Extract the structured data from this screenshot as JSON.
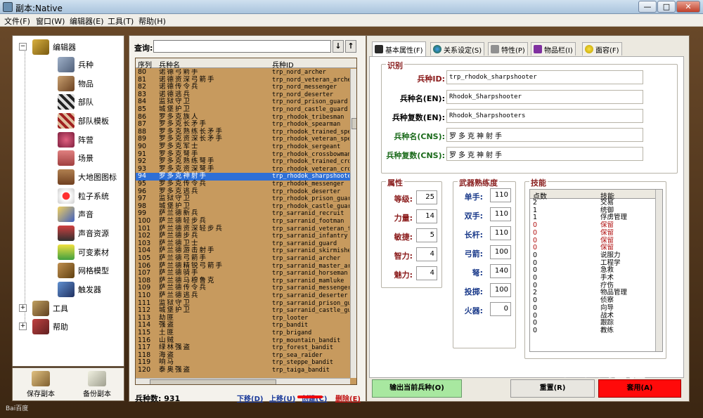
{
  "window": {
    "title": "副本:Native",
    "minimize": "—",
    "maximize": "□",
    "close": "✕"
  },
  "menu": [
    "文件(F)",
    "窗口(W)",
    "编辑器(E)",
    "工具(T)",
    "帮助(H)"
  ],
  "tree": {
    "root_label": "编辑器",
    "children": [
      "兵种",
      "物品",
      "部队",
      "部队模板",
      "阵营",
      "场景",
      "大地图图标",
      "粒子系统",
      "声音",
      "声音资源",
      "可变素材",
      "网格模型",
      "触发器"
    ],
    "tools_label": "工具",
    "help_label": "帮助"
  },
  "bottom_left": {
    "save": "保存副本",
    "backup": "备份副本"
  },
  "query": {
    "label": "查询:",
    "value": "",
    "up": "↓",
    "down": "↑"
  },
  "table": {
    "headers": [
      "序列",
      "兵种名",
      "兵种ID"
    ],
    "rows": [
      [
        "80",
        "诺德弓箭手",
        "trp_nord_archer"
      ],
      [
        "81",
        "诺德资深弓箭手",
        "trp_nord_veteran_archer"
      ],
      [
        "82",
        "诺德传令兵",
        "trp_nord_messenger"
      ],
      [
        "83",
        "诺德逃兵",
        "trp_nord_deserter"
      ],
      [
        "84",
        "监狱守卫",
        "trp_nord_prison_guard"
      ],
      [
        "85",
        "城堡护卫",
        "trp_nord_castle_guard"
      ],
      [
        "86",
        "罗多克族人",
        "trp_rhodok_tribesman"
      ],
      [
        "87",
        "罗多克长矛手",
        "trp_rhodok_spearman"
      ],
      [
        "88",
        "罗多克熟练长矛手",
        "trp_rhodok_trained_spearman"
      ],
      [
        "89",
        "罗多克资深长矛手",
        "trp_rhodok_veteran_spearman"
      ],
      [
        "90",
        "罗多克军士",
        "trp_rhodok_sergeant"
      ],
      [
        "91",
        "罗多克弩手",
        "trp_rhodok_crossbowman"
      ],
      [
        "92",
        "罗多克熟练弩手",
        "trp_rhodok_trained_crossbowman"
      ],
      [
        "93",
        "罗多克资深弩手",
        "trp_rhodok_veteran_crossbowman"
      ],
      [
        "94",
        "罗多克神射手",
        "trp_rhodok_sharpshooter"
      ],
      [
        "95",
        "罗多克传令兵",
        "trp_rhodok_messenger"
      ],
      [
        "96",
        "罗多克逃兵",
        "trp_rhodok_deserter"
      ],
      [
        "97",
        "监狱守卫",
        "trp_rhodok_prison_guard"
      ],
      [
        "98",
        "城堡护卫",
        "trp_rhodok_castle_guard"
      ],
      [
        "99",
        "萨兰德新兵",
        "trp_sarranid_recruit"
      ],
      [
        "100",
        "萨兰德轻步兵",
        "trp_sarranid_footman"
      ],
      [
        "101",
        "萨兰德资深轻步兵",
        "trp_sarranid_veteran_footman"
      ],
      [
        "102",
        "萨兰德步兵",
        "trp_sarranid_infantry"
      ],
      [
        "103",
        "萨兰德卫士",
        "trp_sarranid_guard"
      ],
      [
        "104",
        "萨兰德游击射手",
        "trp_sarranid_skirmisher"
      ],
      [
        "105",
        "萨兰德弓箭手",
        "trp_sarranid_archer"
      ],
      [
        "106",
        "萨兰德精锐弓箭手",
        "trp_sarranid_master_archer"
      ],
      [
        "107",
        "萨兰德骑手",
        "trp_sarranid_horseman"
      ],
      [
        "108",
        "萨兰德马穆鲁克",
        "trp_sarranid_mamluke"
      ],
      [
        "109",
        "萨兰德传令兵",
        "trp_sarranid_messenger"
      ],
      [
        "110",
        "萨兰德逃兵",
        "trp_sarranid_deserter"
      ],
      [
        "111",
        "监狱守卫",
        "trp_sarranid_prison_guard"
      ],
      [
        "112",
        "城堡护卫",
        "trp_sarranid_castle_guard"
      ],
      [
        "113",
        "劫匪",
        "trp_looter"
      ],
      [
        "114",
        "强盗",
        "trp_bandit"
      ],
      [
        "115",
        "土匪",
        "trp_brigand"
      ],
      [
        "116",
        "山贼",
        "trp_mountain_bandit"
      ],
      [
        "117",
        "绿林强盗",
        "trp_forest_bandit"
      ],
      [
        "118",
        "海盗",
        "trp_sea_raider"
      ],
      [
        "119",
        "响马",
        "trp_steppe_bandit"
      ],
      [
        "120",
        "泰奥强盗",
        "trp_taiga_bandit"
      ]
    ],
    "selected_index": 14
  },
  "count": {
    "label": "兵种数:",
    "value": "931"
  },
  "actions": {
    "down": "下移(D)",
    "up": "上移(U)",
    "create": "创建(C)",
    "delete": "删除(E)"
  },
  "tabs": [
    "基本属性(F)",
    "关系设定(S)",
    "特性(P)",
    "物品栏(I)",
    "面容(F)"
  ],
  "identity": {
    "title": "识别",
    "id_label": "兵种ID:",
    "id_value": "trp_rhodok_sharpshooter",
    "name_en_label": "兵种名(EN):",
    "name_en_value": "Rhodok_Sharpshooter",
    "plural_en_label": "兵种复数(EN):",
    "plural_en_value": "Rhodok_Sharpshooters",
    "name_cns_label": "兵种名(CNS):",
    "name_cns_value": "罗多克神射手",
    "plural_cns_label": "兵种复数(CNS):",
    "plural_cns_value": "罗多克神射手"
  },
  "attributes": {
    "title": "属性",
    "items": [
      [
        "等级:",
        "25"
      ],
      [
        "力量:",
        "14"
      ],
      [
        "敏捷:",
        "5"
      ],
      [
        "智力:",
        "4"
      ],
      [
        "魅力:",
        "4"
      ]
    ]
  },
  "weapons": {
    "title": "武器熟练度",
    "items": [
      [
        "单手:",
        "110"
      ],
      [
        "双手:",
        "110"
      ],
      [
        "长杆:",
        "110"
      ],
      [
        "弓箭:",
        "100"
      ],
      [
        "弩:",
        "140"
      ],
      [
        "投掷:",
        "100"
      ],
      [
        "火器:",
        "0"
      ]
    ]
  },
  "skills": {
    "title": "技能",
    "headers": [
      "点数",
      "技能"
    ],
    "rows": [
      [
        "2",
        "交易"
      ],
      [
        "1",
        "统御"
      ],
      [
        "1",
        "俘虏管理"
      ],
      [
        "0",
        "保留"
      ],
      [
        "0",
        "保留"
      ],
      [
        "0",
        "保留"
      ],
      [
        "0",
        "保留"
      ],
      [
        "0",
        "说服力"
      ],
      [
        "0",
        "工程学"
      ],
      [
        "0",
        "急救"
      ],
      [
        "0",
        "手术"
      ],
      [
        "0",
        "疗伤"
      ],
      [
        "2",
        "物品管理"
      ],
      [
        "0",
        "侦察"
      ],
      [
        "0",
        "向导"
      ],
      [
        "0",
        "战术"
      ],
      [
        "0",
        "跟踪"
      ],
      [
        "0",
        "教练"
      ]
    ],
    "reserved_color": "#b01010"
  },
  "buttons": {
    "export": "输出当前兵种(O)",
    "reset": "重置(R)",
    "apply": "套用(A)"
  },
  "watermark": "Baidu经验",
  "source_tag": "Bai百度"
}
